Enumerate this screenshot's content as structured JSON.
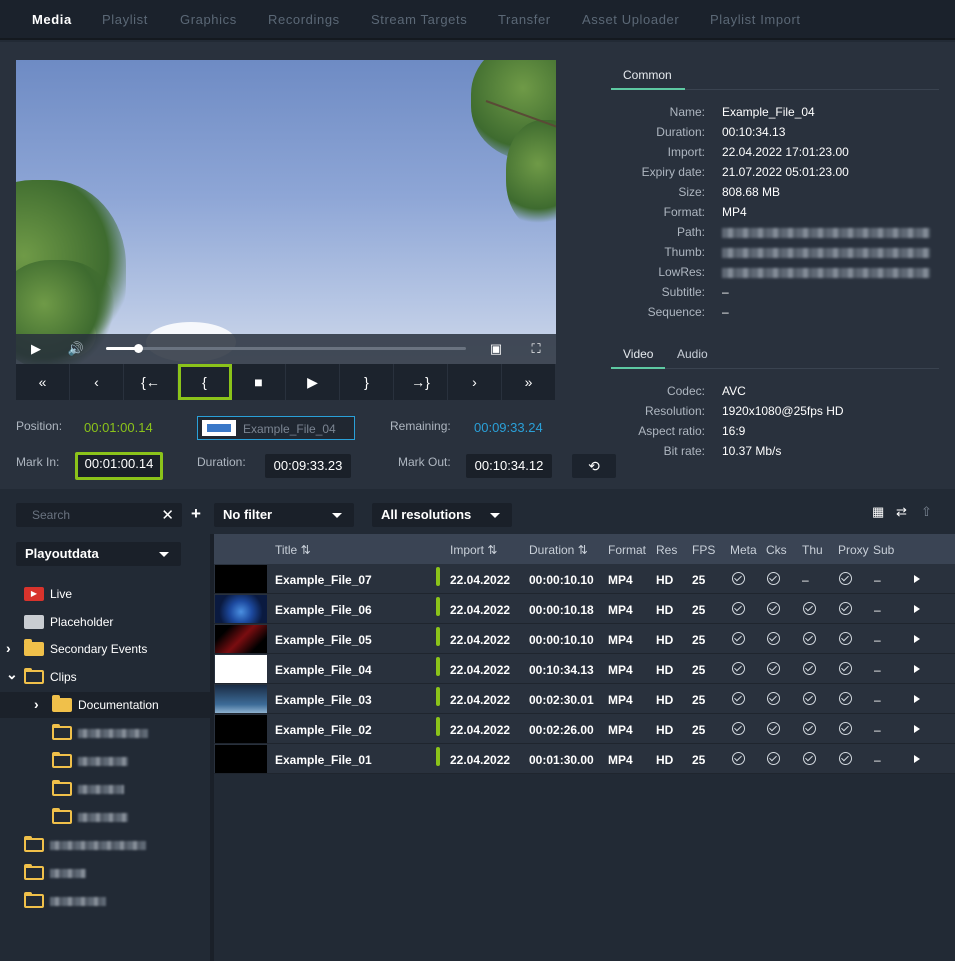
{
  "nav": {
    "tabs": [
      "Media",
      "Playlist",
      "Graphics",
      "Recordings",
      "Stream Targets",
      "Transfer",
      "Asset Uploader",
      "Playlist Import"
    ],
    "active": 0
  },
  "player": {
    "progress": 0.09
  },
  "transport": [
    "«",
    "‹",
    "{←",
    "{",
    "■",
    "▶",
    "}",
    "→}",
    "›",
    "»"
  ],
  "timing": {
    "position_label": "Position:",
    "position": "00:01:00.14",
    "clip_name": "Example_File_04",
    "remaining_label": "Remaining:",
    "remaining": "00:09:33.24",
    "mark_in_label": "Mark In:",
    "mark_in": "00:01:00.14",
    "duration_label": "Duration:",
    "duration": "00:09:33.23",
    "mark_out_label": "Mark Out:",
    "mark_out": "00:10:34.12"
  },
  "props": {
    "common_tab": "Common",
    "common": [
      {
        "k": "Name:",
        "v": "Example_File_04"
      },
      {
        "k": "Duration:",
        "v": "00:10:34.13"
      },
      {
        "k": "Import:",
        "v": "22.04.2022 17:01:23.00"
      },
      {
        "k": "Expiry date:",
        "v": "21.07.2022 05:01:23.00"
      },
      {
        "k": "Size:",
        "v": "808.68 MB"
      },
      {
        "k": "Format:",
        "v": "MP4"
      },
      {
        "k": "Path:",
        "v": "",
        "blur": true
      },
      {
        "k": "Thumb:",
        "v": "",
        "blur": true
      },
      {
        "k": "LowRes:",
        "v": "",
        "blur": true
      },
      {
        "k": "Subtitle:",
        "v": "–"
      },
      {
        "k": "Sequence:",
        "v": "–"
      }
    ],
    "video_tab": "Video",
    "audio_tab": "Audio",
    "video": [
      {
        "k": "Codec:",
        "v": "AVC"
      },
      {
        "k": "Resolution:",
        "v": "1920x1080@25fps   HD"
      },
      {
        "k": "Aspect ratio:",
        "v": "16:9"
      },
      {
        "k": "Bit rate:",
        "v": "10.37 Mb/s"
      }
    ]
  },
  "filters": {
    "search_placeholder": "Search",
    "filter": "No filter",
    "resolution": "All resolutions"
  },
  "tree": {
    "root": "Playoutdata",
    "live": "Live",
    "placeholder": "Placeholder",
    "secondary": "Secondary Events",
    "clips": "Clips",
    "documentation": "Documentation"
  },
  "table": {
    "headers": {
      "title": "Title",
      "import": "Import",
      "duration": "Duration",
      "format": "Format",
      "res": "Res",
      "fps": "FPS",
      "meta": "Meta",
      "cks": "Cks",
      "thu": "Thu",
      "proxy": "Proxy",
      "sub": "Sub"
    },
    "rows": [
      {
        "title": "Example_File_07",
        "import": "22.04.2022",
        "duration": "00:00:10.10",
        "format": "MP4",
        "res": "HD",
        "fps": "25",
        "thu": "–",
        "sub": "–"
      },
      {
        "title": "Example_File_06",
        "import": "22.04.2022",
        "duration": "00:00:10.18",
        "format": "MP4",
        "res": "HD",
        "fps": "25",
        "thu": "",
        "sub": "–"
      },
      {
        "title": "Example_File_05",
        "import": "22.04.2022",
        "duration": "00:00:10.10",
        "format": "MP4",
        "res": "HD",
        "fps": "25",
        "thu": "",
        "sub": "–"
      },
      {
        "title": "Example_File_04",
        "import": "22.04.2022",
        "duration": "00:10:34.13",
        "format": "MP4",
        "res": "HD",
        "fps": "25",
        "thu": "",
        "sub": "–"
      },
      {
        "title": "Example_File_03",
        "import": "22.04.2022",
        "duration": "00:02:30.01",
        "format": "MP4",
        "res": "HD",
        "fps": "25",
        "thu": "",
        "sub": "–"
      },
      {
        "title": "Example_File_02",
        "import": "22.04.2022",
        "duration": "00:02:26.00",
        "format": "MP4",
        "res": "HD",
        "fps": "25",
        "thu": "",
        "sub": "–"
      },
      {
        "title": "Example_File_01",
        "import": "22.04.2022",
        "duration": "00:01:30.00",
        "format": "MP4",
        "res": "HD",
        "fps": "25",
        "thu": "",
        "sub": "–"
      }
    ]
  }
}
